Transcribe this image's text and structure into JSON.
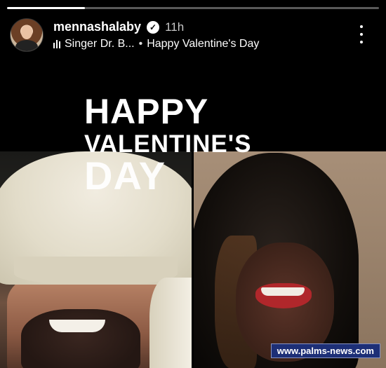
{
  "story": {
    "progress": 0.21,
    "username": "mennashalaby",
    "verified_icon": "verified-badge-icon",
    "time": "11h",
    "music_track": "Singer Dr. B...",
    "separator": "•",
    "sticker_text": "Happy Valentine's Day",
    "more_icon": "more-vertical-icon"
  },
  "overlay_text": {
    "line1": "HAPPY",
    "line2": "VALENTINE'S",
    "line3": "DAY"
  },
  "watermark": "www.palms-news.com"
}
